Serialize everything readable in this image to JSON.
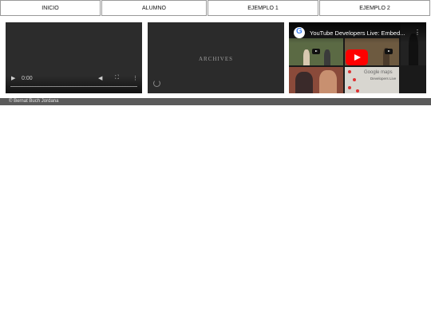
{
  "nav": {
    "items": [
      {
        "label": "INICIO"
      },
      {
        "label": "ALUMNO"
      },
      {
        "label": "EJEMPLO 1"
      },
      {
        "label": "EJEMPLO 2"
      }
    ]
  },
  "video_player": {
    "play_icon": "play-icon",
    "time": "0:00",
    "volume_icon": "volume-icon",
    "fullscreen_icon": "fullscreen-icon",
    "menu_icon": "more-vertical-icon"
  },
  "flash_embed": {
    "title": "ARCHIVES"
  },
  "youtube_embed": {
    "title": "YouTube Developers Live: Embed...",
    "maps_label": "Google maps",
    "maps_sub": "Developers Live",
    "colors": {
      "play": "#ff0000",
      "google_blue": "#4285f4"
    }
  },
  "footer": {
    "copyright": "© Bernat Buch Jordana"
  }
}
